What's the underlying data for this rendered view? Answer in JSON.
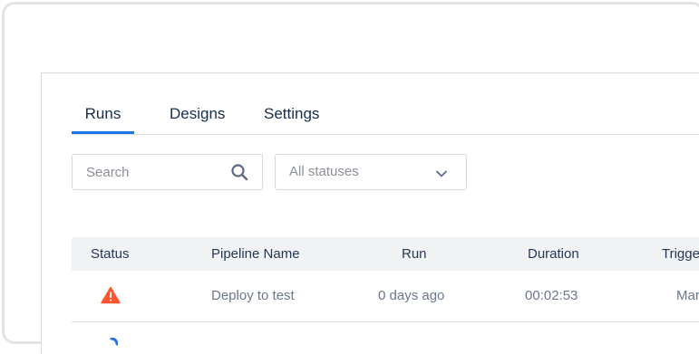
{
  "tabs": [
    {
      "label": "Runs",
      "active": true
    },
    {
      "label": "Designs",
      "active": false
    },
    {
      "label": "Settings",
      "active": false
    }
  ],
  "search": {
    "placeholder": "Search",
    "icon": "search-icon"
  },
  "status_filter": {
    "value": "All statuses",
    "icon": "chevron-down-icon"
  },
  "table": {
    "columns": [
      "Status",
      "Pipeline Name",
      "Run",
      "Duration",
      "Trigger"
    ],
    "rows": [
      {
        "status_icon": "warning-icon",
        "status_color": "#ff5630",
        "pipeline_name": "Deploy to test",
        "run": "0 days ago",
        "duration": "00:02:53",
        "trigger": "Mar"
      }
    ]
  },
  "colors": {
    "accent": "#1f74e6",
    "warning": "#ff5630"
  }
}
